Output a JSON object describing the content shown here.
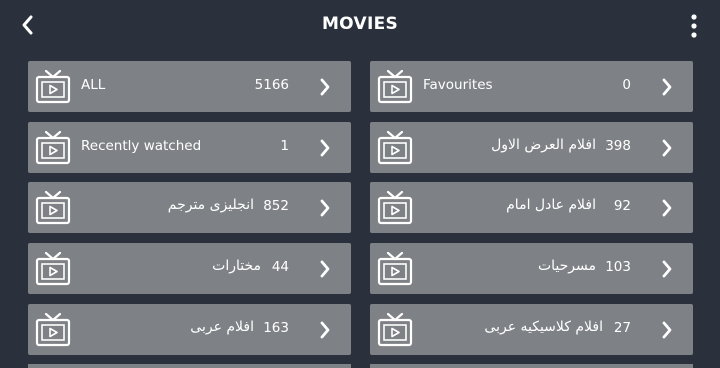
{
  "header": {
    "title": "MOVIES",
    "back_icon": "chevron-left-icon",
    "more_icon": "more-vertical-icon"
  },
  "colors": {
    "background": "#2a313c",
    "tile": "#7e8185",
    "text": "#ffffff"
  },
  "categories": [
    {
      "label": "ALL",
      "count": "5166",
      "lang": "en"
    },
    {
      "label": "Favourites",
      "count": "0",
      "lang": "en"
    },
    {
      "label": "Recently watched",
      "count": "1",
      "lang": "en"
    },
    {
      "label": "افلام العرض الاول",
      "count": "398",
      "lang": "ar"
    },
    {
      "label": "انجليزى مترجم",
      "count": "852",
      "lang": "ar"
    },
    {
      "label": "افلام عادل امام",
      "count": "92",
      "lang": "ar"
    },
    {
      "label": "مختارات",
      "count": "44",
      "lang": "ar"
    },
    {
      "label": "مسرحيات",
      "count": "103",
      "lang": "ar"
    },
    {
      "label": "افلام عربى",
      "count": "163",
      "lang": "ar"
    },
    {
      "label": "افلام كلاسيكيه عربى",
      "count": "27",
      "lang": "ar"
    }
  ]
}
